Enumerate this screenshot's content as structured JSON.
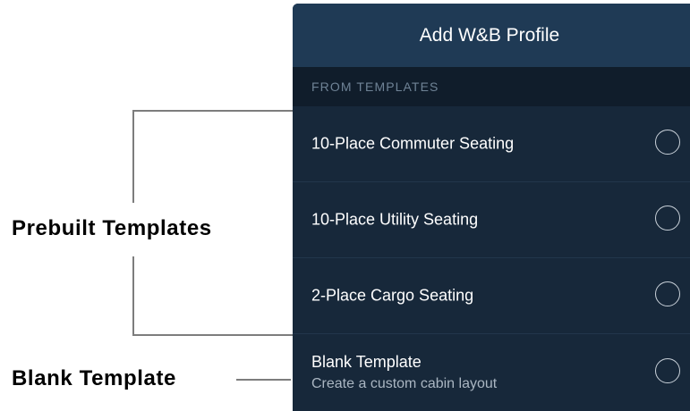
{
  "annotations": {
    "prebuilt_label": "Prebuilt Templates",
    "blank_label": "Blank Template"
  },
  "panel": {
    "title": "Add W&B Profile",
    "section_header": "FROM TEMPLATES",
    "items": [
      {
        "title": "10-Place Commuter Seating",
        "selected": false
      },
      {
        "title": "10-Place Utility Seating",
        "selected": false
      },
      {
        "title": "2-Place Cargo Seating",
        "selected": false
      },
      {
        "title": "Blank Template",
        "subtitle": "Create a custom cabin layout",
        "selected": false
      }
    ]
  },
  "colors": {
    "header_bg": "#1f3a55",
    "section_bg": "#101d2b",
    "row_bg": "#17283a",
    "divider": "#22364b",
    "annotation_line": "#7d7d7d"
  }
}
